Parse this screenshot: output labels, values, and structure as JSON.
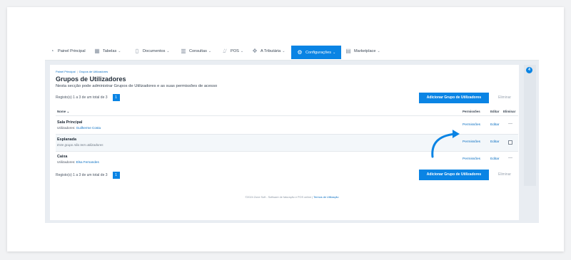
{
  "nav": {
    "items": [
      {
        "label": "Painel Principal",
        "icon": "dashboard-icon",
        "chevron": false
      },
      {
        "label": "Tabelas",
        "icon": "table-icon",
        "chevron": true
      },
      {
        "label": "Documentos",
        "icon": "document-icon",
        "chevron": true
      },
      {
        "label": "Consultas",
        "icon": "chart-icon",
        "chevron": true
      },
      {
        "label": "POS",
        "icon": "pos-icon",
        "chevron": true
      },
      {
        "label": "A Tributária",
        "icon": "tax-icon",
        "chevron": true
      },
      {
        "label": "Configurações",
        "icon": "settings-icon",
        "chevron": true,
        "active": true
      },
      {
        "label": "Marketplace",
        "icon": "marketplace-icon",
        "chevron": true
      }
    ],
    "side_badge": "4"
  },
  "breadcrumb": {
    "home": "Painel Principal",
    "current": "Grupos de Utilizadores"
  },
  "page": {
    "title": "Grupos de Utilizadores",
    "subtitle": "Nesta secção pode administrar Grupos de Utilizadores e as suas permissões de acesso"
  },
  "toolbar_top": {
    "records": "Registo(s) 1 a 3 de um total de 3",
    "page": "1",
    "add_label": "Adicionar Grupo de Utilizadores",
    "delete_label": "Eliminar"
  },
  "table": {
    "headers": {
      "name": "Nome",
      "permissions": "Permissões",
      "edit": "Editar",
      "delete": "Eliminar"
    },
    "rows": [
      {
        "name": "Sala Principal",
        "users_prefix": "Utilizadores:",
        "users": "Guilherme Costa",
        "permissions": "Permissões",
        "edit": "Editar"
      },
      {
        "name": "Esplanada",
        "note": "Este grupo não tem utilizadores",
        "permissions": "Permissões",
        "edit": "Editar"
      },
      {
        "name": "Caixa",
        "users_prefix": "Utilizadores:",
        "users": "Elsa Fernandes",
        "permissions": "Permissões",
        "edit": "Editar"
      }
    ]
  },
  "toolbar_bottom": {
    "records": "Registo(s) 1 a 3 de um total de 3",
    "page": "1",
    "add_label": "Adicionar Grupo de Utilizadores",
    "delete_label": "Eliminar"
  },
  "footer": {
    "text": "©2024 Zone Soft - Software de faturação e POS online |",
    "terms": "Termos de Utilização"
  },
  "colors": {
    "accent": "#0a84e4",
    "link": "#0a6fc2",
    "arrow": "#0a84e4"
  }
}
